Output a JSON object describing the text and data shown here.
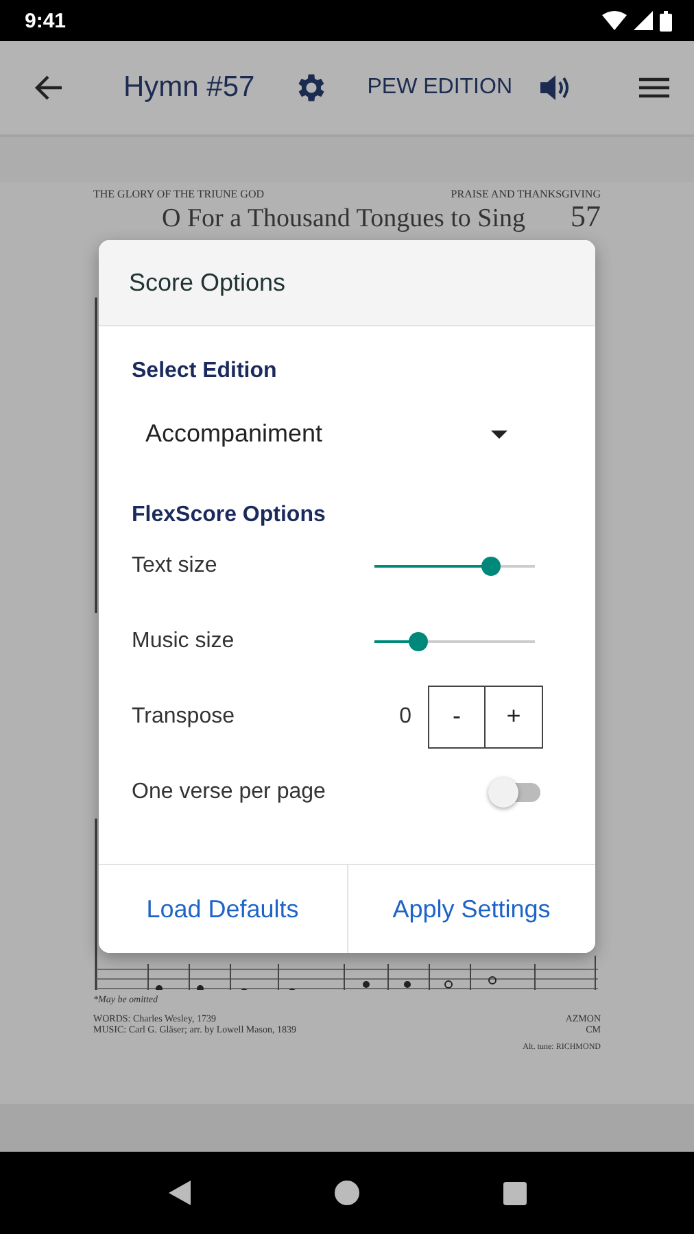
{
  "status_bar": {
    "time": "9:41"
  },
  "app_bar": {
    "title": "Hymn #57",
    "edition_button": "PEW EDITION"
  },
  "sheet": {
    "header_left": "THE GLORY OF THE TRIUNE GOD",
    "header_right": "PRAISE AND THANKSGIVING",
    "title": "O For a Thousand Tongues to Sing",
    "number": "57",
    "footnote": "*May be omitted",
    "credits": [
      "WORDS: Charles Wesley, 1739",
      "MUSIC: Carl G. Gläser; arr. by Lowell Mason, 1839"
    ],
    "tune": [
      "AZMON",
      "CM"
    ],
    "alt_tune": "Alt. tune: RICHMOND"
  },
  "dialog": {
    "title": "Score Options",
    "edition_heading": "Select Edition",
    "edition_value": "Accompaniment",
    "options_heading": "FlexScore Options",
    "options": [
      {
        "kind": "slider",
        "label": "Text size",
        "level": 0.73
      },
      {
        "kind": "slider",
        "label": "Music size",
        "level": 0.27
      },
      {
        "kind": "stepper",
        "label": "Transpose",
        "value": "0",
        "minus": "-",
        "plus": "+"
      },
      {
        "kind": "switch",
        "label": "One verse per page",
        "on": false
      }
    ],
    "buttons": [
      "Load Defaults",
      "Apply Settings"
    ]
  }
}
